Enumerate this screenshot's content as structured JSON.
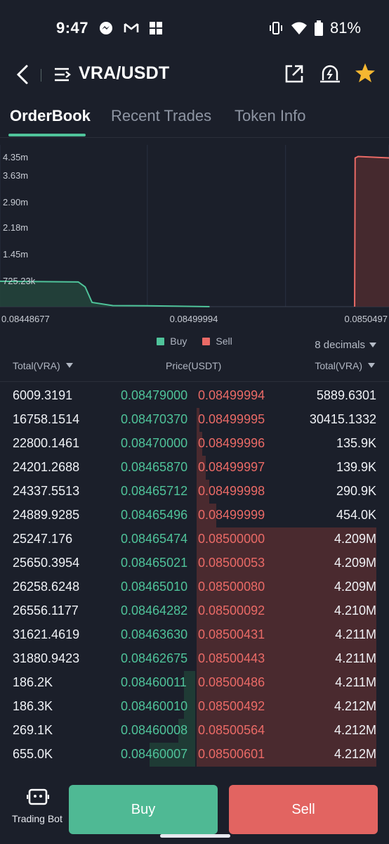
{
  "status": {
    "time": "9:47",
    "battery": "81%"
  },
  "header": {
    "pair": "VRA/USDT"
  },
  "tabs": [
    {
      "label": "OrderBook"
    },
    {
      "label": "Recent Trades"
    },
    {
      "label": "Token Info"
    }
  ],
  "chart_data": {
    "type": "area",
    "yticks": [
      "4.35m",
      "3.63m",
      "2.90m",
      "2.18m",
      "1.45m",
      "725.23k"
    ],
    "xticks": [
      "0.08448677",
      "0.08499994",
      "0.0850497"
    ],
    "legend": [
      "Buy",
      "Sell"
    ],
    "series": [
      {
        "name": "Buy",
        "color": "#4fc39a",
        "x": [
          0.08448677,
          0.0846,
          0.08461,
          0.08462,
          0.08465,
          0.0847,
          0.08479
        ],
        "y": [
          720000,
          700000,
          560000,
          120000,
          30000,
          25000,
          0
        ]
      },
      {
        "name": "Sell",
        "color": "#ea6a66",
        "x": [
          0.08499994,
          0.085,
          0.0850049,
          0.0850497
        ],
        "y": [
          30000,
          4209000,
          4250000,
          4212000
        ]
      }
    ]
  },
  "controls": {
    "decimals": "8 decimals",
    "buy_col": "Total(VRA)",
    "price_col": "Price(USDT)",
    "sell_col": "Total(VRA)"
  },
  "book": [
    {
      "bt": "6009.3191",
      "bp": "0.08479000",
      "sp": "0.08499994",
      "st": "5889.6301",
      "bd": 0.0,
      "sd": 0.0
    },
    {
      "bt": "16758.1514",
      "bp": "0.08470370",
      "sp": "0.08499995",
      "st": "30415.1332",
      "bd": 0.0,
      "sd": 0.01
    },
    {
      "bt": "22800.1461",
      "bp": "0.08470000",
      "sp": "0.08499996",
      "st": "135.9K",
      "bd": 0.0,
      "sd": 0.03
    },
    {
      "bt": "24201.2688",
      "bp": "0.08465870",
      "sp": "0.08499997",
      "st": "139.9K",
      "bd": 0.0,
      "sd": 0.05
    },
    {
      "bt": "24337.5513",
      "bp": "0.08465712",
      "sp": "0.08499998",
      "st": "290.9K",
      "bd": 0.0,
      "sd": 0.07
    },
    {
      "bt": "24889.9285",
      "bp": "0.08465496",
      "sp": "0.08499999",
      "st": "454.0K",
      "bd": 0.0,
      "sd": 0.11
    },
    {
      "bt": "25247.176",
      "bp": "0.08465474",
      "sp": "0.08500000",
      "st": "4.209M",
      "bd": 0.0,
      "sd": 1.0
    },
    {
      "bt": "25650.3954",
      "bp": "0.08465021",
      "sp": "0.08500053",
      "st": "4.209M",
      "bd": 0.0,
      "sd": 1.0
    },
    {
      "bt": "26258.6248",
      "bp": "0.08465010",
      "sp": "0.08500080",
      "st": "4.209M",
      "bd": 0.0,
      "sd": 1.0
    },
    {
      "bt": "26556.1177",
      "bp": "0.08464282",
      "sp": "0.08500092",
      "st": "4.210M",
      "bd": 0.0,
      "sd": 1.0
    },
    {
      "bt": "31621.4619",
      "bp": "0.08463630",
      "sp": "0.08500431",
      "st": "4.211M",
      "bd": 0.0,
      "sd": 1.0
    },
    {
      "bt": "31880.9423",
      "bp": "0.08462675",
      "sp": "0.08500443",
      "st": "4.211M",
      "bd": 0.0,
      "sd": 1.0
    },
    {
      "bt": "186.2K",
      "bp": "0.08460011",
      "sp": "0.08500486",
      "st": "4.211M",
      "bd": 0.02,
      "sd": 1.0
    },
    {
      "bt": "186.3K",
      "bp": "0.08460010",
      "sp": "0.08500492",
      "st": "4.212M",
      "bd": 0.02,
      "sd": 1.0
    },
    {
      "bt": "269.1K",
      "bp": "0.08460008",
      "sp": "0.08500564",
      "st": "4.212M",
      "bd": 0.03,
      "sd": 1.0
    },
    {
      "bt": "655.0K",
      "bp": "0.08460007",
      "sp": "0.08500601",
      "st": "4.212M",
      "bd": 0.08,
      "sd": 1.0
    }
  ],
  "bottom": {
    "bot_label": "Trading Bot",
    "buy": "Buy",
    "sell": "Sell"
  }
}
